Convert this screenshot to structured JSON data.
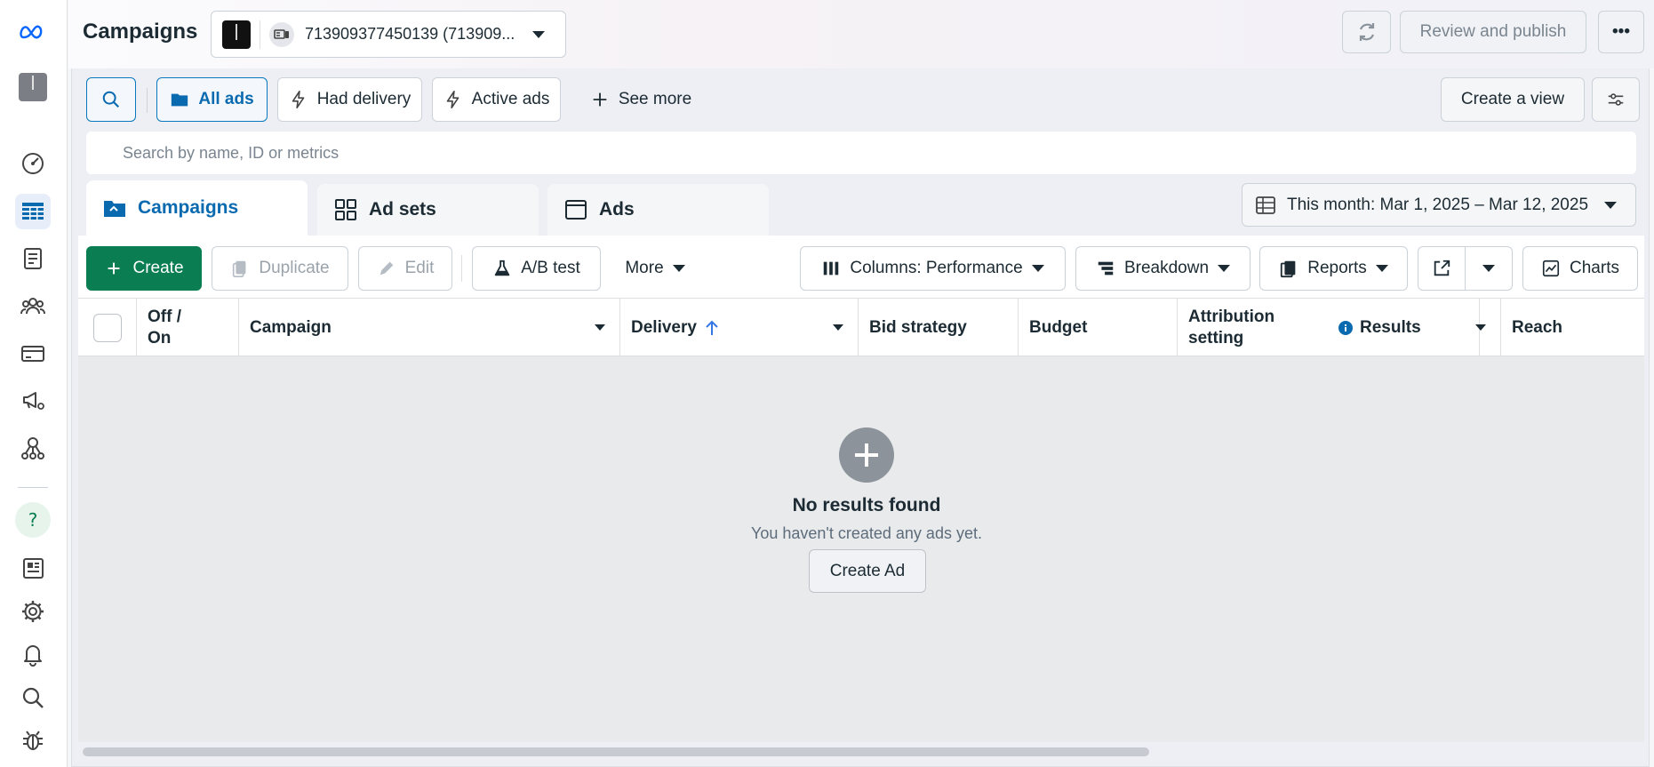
{
  "header": {
    "title": "Campaigns",
    "account_label": "713909377450139 (713909...",
    "review_publish": "Review and publish"
  },
  "filters": {
    "all_ads": "All ads",
    "had_delivery": "Had delivery",
    "active_ads": "Active ads",
    "see_more": "See more",
    "create_view": "Create a view"
  },
  "search": {
    "placeholder": "Search by name, ID or metrics"
  },
  "tabs": [
    {
      "label": "Campaigns"
    },
    {
      "label": "Ad sets"
    },
    {
      "label": "Ads"
    }
  ],
  "date_range": "This month: Mar 1, 2025 – Mar 12, 2025",
  "toolbar": {
    "create": "Create",
    "duplicate": "Duplicate",
    "edit": "Edit",
    "ab_test": "A/B test",
    "more": "More",
    "columns": "Columns: Performance",
    "breakdown": "Breakdown",
    "reports": "Reports",
    "charts": "Charts"
  },
  "table": {
    "columns": [
      {
        "label": "Off /\nOn"
      },
      {
        "label": "Campaign"
      },
      {
        "label": "Delivery"
      },
      {
        "label": "Bid strategy"
      },
      {
        "label": "Budget"
      },
      {
        "label": "Attribution\nsetting"
      },
      {
        "label": "Results"
      },
      {
        "label": "Reach"
      }
    ]
  },
  "empty_state": {
    "title": "No results found",
    "subtitle": "You haven't created any ads yet.",
    "button": "Create Ad"
  },
  "colors": {
    "accent": "#0a6ab0",
    "create_green": "#0a7d52",
    "meta_blue": "#0866ff"
  }
}
